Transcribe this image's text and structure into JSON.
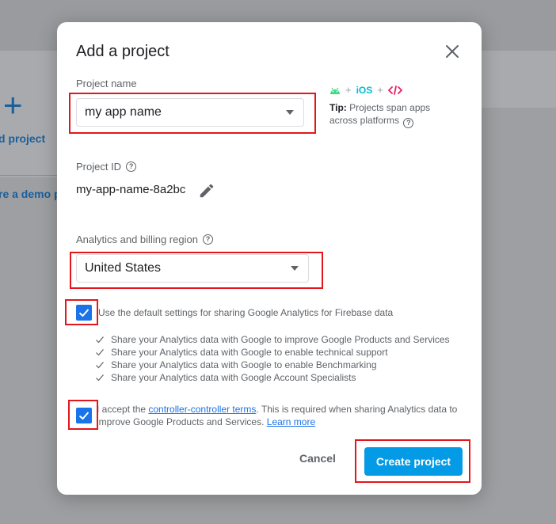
{
  "background": {
    "add_project_label": "d project",
    "demo_label": "re a demo p"
  },
  "dialog": {
    "title": "Add a project",
    "project_name": {
      "label": "Project name",
      "value": "my app name"
    },
    "tip": {
      "platforms": [
        "android",
        "iOS",
        "web"
      ],
      "bold": "Tip:",
      "text": "Projects span apps across platforms"
    },
    "project_id": {
      "label": "Project ID",
      "value": "my-app-name-8a2bc"
    },
    "analytics_region": {
      "label": "Analytics and billing region",
      "value": "United States"
    },
    "default_settings": {
      "checked": true,
      "label": "Use the default settings for sharing Google Analytics for Firebase data",
      "items": [
        "Share your Analytics data with Google to improve Google Products and Services",
        "Share your Analytics data with Google to enable technical support",
        "Share your Analytics data with Google to enable Benchmarking",
        "Share your Analytics data with Google Account Specialists"
      ]
    },
    "terms": {
      "checked": true,
      "prefix": "I accept the ",
      "link": "controller-controller terms",
      "middle": ". This is required when sharing Analytics data to improve Google Products and Services. ",
      "learn_more": "Learn more"
    },
    "buttons": {
      "cancel": "Cancel",
      "create": "Create project"
    }
  },
  "colors": {
    "primary": "#039be5",
    "checkbox": "#1a73e8",
    "annotation_red": "#e3161c",
    "android_green": "#3ddc84",
    "ios_teal": "#00bcd4",
    "web_pink": "#e91e63"
  }
}
